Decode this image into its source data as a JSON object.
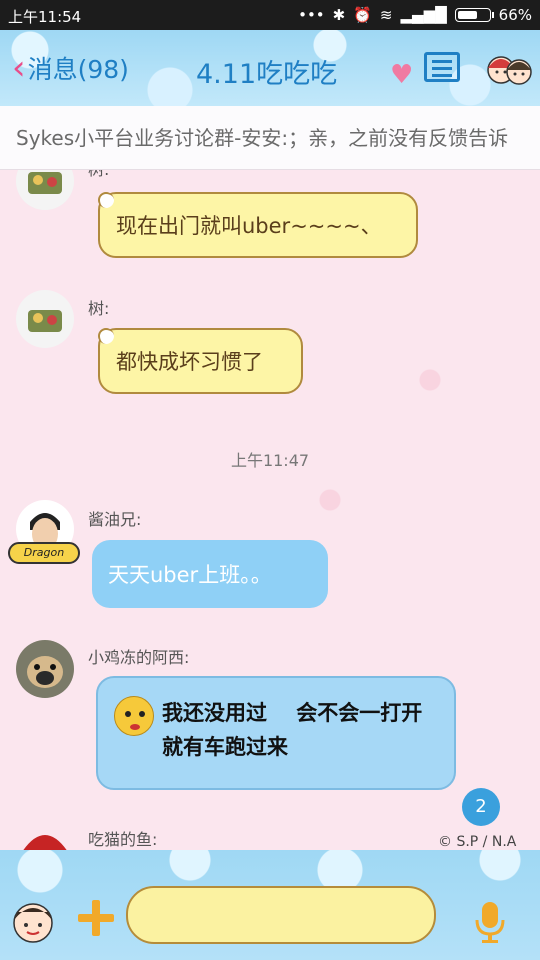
{
  "status_bar": {
    "time": "上午11:54",
    "icons": [
      "dots-icon",
      "bluetooth-icon",
      "alarm-icon",
      "wifi-icon",
      "signal-icon"
    ],
    "battery": "66%",
    "battery_level": 0.66
  },
  "header": {
    "back_label": "消息(98)",
    "title": "4.11吃吃吃"
  },
  "notice": {
    "text": "Sykes小平台业务讨论群-安安:；亲，之前没有反馈告诉"
  },
  "messages": [
    {
      "sender": "树:",
      "text": "现在出门就叫uber~~~~、",
      "bubble": "yellow"
    },
    {
      "sender": "树:",
      "text": "都快成坏习惯了",
      "bubble": "yellow"
    },
    {
      "timestamp": "上午11:47"
    },
    {
      "sender": "酱油兄:",
      "text": "天天uber上班。。",
      "bubble": "blue"
    },
    {
      "sender": "小鸡冻的阿西:",
      "text": "我还没用过    会不会一打开 就有车跑过来",
      "bubble": "blue-emoji"
    },
    {
      "sender": "吃猫的鱼:"
    }
  ],
  "unread_count": "2",
  "watermark": "© S.P / N.A",
  "colors": {
    "title_blue": "#1f7fc4",
    "bubble_yellow": "#fdf5a6",
    "bubble_blue": "#8fd0f6",
    "background_pink": "#fbe6ee"
  },
  "input": {
    "placeholder": ""
  }
}
